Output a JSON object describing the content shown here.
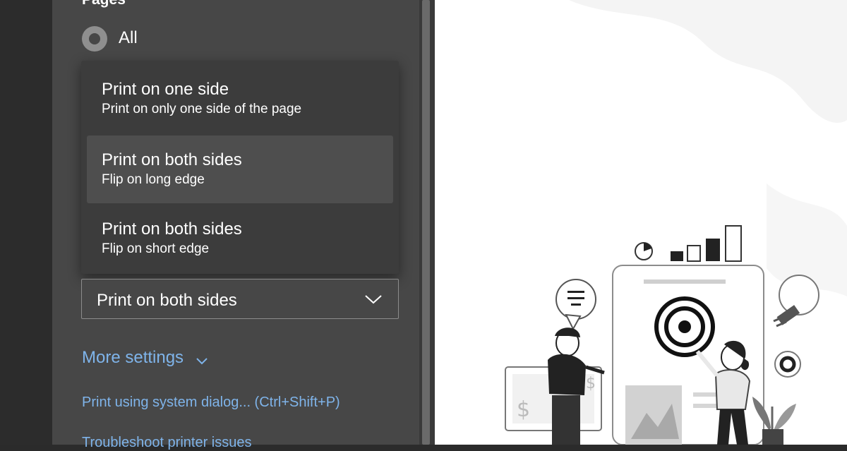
{
  "pages": {
    "title": "Pages",
    "all_label": "All"
  },
  "duplex_menu": {
    "options": [
      {
        "title": "Print on one side",
        "subtitle": "Print on only one side of the page"
      },
      {
        "title": "Print on both sides",
        "subtitle": "Flip on long edge"
      },
      {
        "title": "Print on both sides",
        "subtitle": "Flip on short edge"
      }
    ],
    "selected_index": 1
  },
  "duplex_select": {
    "value": "Print on both sides"
  },
  "links": {
    "more_settings": "More settings",
    "system_dialog": "Print using system dialog... (Ctrl+Shift+P)",
    "troubleshoot": "Troubleshoot printer issues"
  },
  "preview_illustration": {
    "bars_label": "$"
  },
  "colors": {
    "panel": "#474747",
    "menu": "#3c3c3c",
    "menu_selected": "#4e4e4e",
    "link": "#7fb4ea"
  }
}
